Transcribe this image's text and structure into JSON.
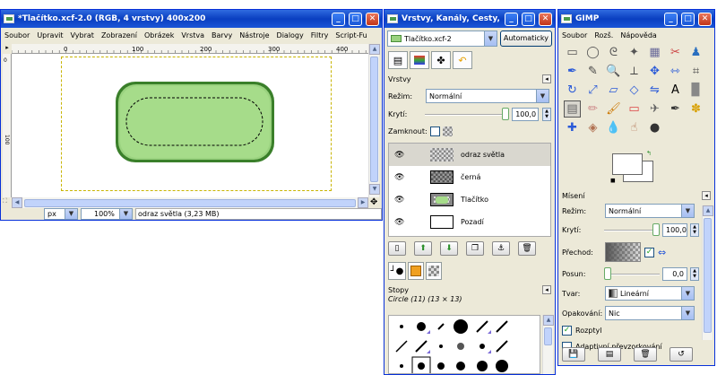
{
  "image_window": {
    "title": "*Tlačítko.xcf-2.0 (RGB, 4 vrstvy) 400x200",
    "menus": [
      "Soubor",
      "Upravit",
      "Vybrat",
      "Zobrazení",
      "Obrázek",
      "Vrstva",
      "Barvy",
      "Nástroje",
      "Dialogy",
      "Filtry",
      "Script-Fu"
    ],
    "ruler_labels": [
      "0",
      "100",
      "200",
      "300",
      "400"
    ],
    "unit": "px",
    "zoom": "100%",
    "status": "odraz světla (3,23 MB)",
    "colors": {
      "button_fill": "#a6dc8a",
      "button_border": "#4a8f3a"
    }
  },
  "layers_window": {
    "title": "Vrstvy, Kanály, Cesty, ...",
    "image_select": "Tlačítko.xcf-2",
    "auto_button": "Automaticky",
    "panel_title": "Vrstvy",
    "mode_label": "Režim:",
    "mode_value": "Normální",
    "opacity_label": "Krytí:",
    "opacity_value": "100,0",
    "opacity_level": 1.0,
    "lock_label": "Zamknout:",
    "layers": [
      {
        "name": "odraz světla",
        "selected": true
      },
      {
        "name": "černá",
        "selected": false
      },
      {
        "name": "Tlačítko",
        "selected": false
      },
      {
        "name": "Pozadí",
        "selected": false
      }
    ],
    "brushes_title": "Stopy",
    "brush_selected": "Circle (11) (13 × 13)"
  },
  "toolbox": {
    "title": "GIMP",
    "menus": [
      "Soubor",
      "Rozš.",
      "Nápověda"
    ],
    "tool_icons": [
      "rect-select-icon",
      "ellipse-select-icon",
      "lasso-icon",
      "magic-wand-icon",
      "color-select-icon",
      "scissors-icon",
      "foreground-select-icon",
      "paths-icon",
      "color-picker-icon",
      "zoom-icon",
      "measure-icon",
      "move-icon",
      "align-icon",
      "crop-icon",
      "rotate-icon",
      "scale-icon",
      "shear-icon",
      "perspective-icon",
      "flip-icon",
      "text-icon",
      "bucket-fill-icon",
      "blend-icon",
      "pencil-icon",
      "paintbrush-icon",
      "eraser-icon",
      "airbrush-icon",
      "ink-icon",
      "clone-icon",
      "heal-icon",
      "perspective-clone-icon",
      "blur-icon",
      "smudge-icon",
      "dodge-burn-icon"
    ],
    "tool_glyphs": [
      "▭",
      "◯",
      "ᘓ",
      "✦",
      "▦",
      "✂",
      "♟",
      "✒",
      "✎",
      "🔍",
      "⟂",
      "✥",
      "⇿",
      "⌗",
      "↻",
      "⤢",
      "▱",
      "◇",
      "⇋",
      "A",
      "▉",
      "▤",
      "✏",
      "🖌",
      "▭",
      "✈",
      "✒",
      "✽",
      "✚",
      "◈",
      "💧",
      "☝",
      "●"
    ],
    "fg_color": "#000000",
    "bg_color": "#ffffff",
    "options_title": "Mísení",
    "mode_label": "Režim:",
    "mode_value": "Normální",
    "opacity_label": "Krytí:",
    "opacity_value": "100,0",
    "opacity_level": 1.0,
    "gradient_label": "Přechod:",
    "offset_label": "Posun:",
    "offset_value": "0,0",
    "offset_level": 0.0,
    "shape_label": "Tvar:",
    "shape_value": "Lineární",
    "repeat_label": "Opakování:",
    "repeat_value": "Nic",
    "dither_label": "Rozptyl",
    "dither_checked": true,
    "adaptive_label": "Adaptivní převzorkování",
    "adaptive_checked": false
  }
}
